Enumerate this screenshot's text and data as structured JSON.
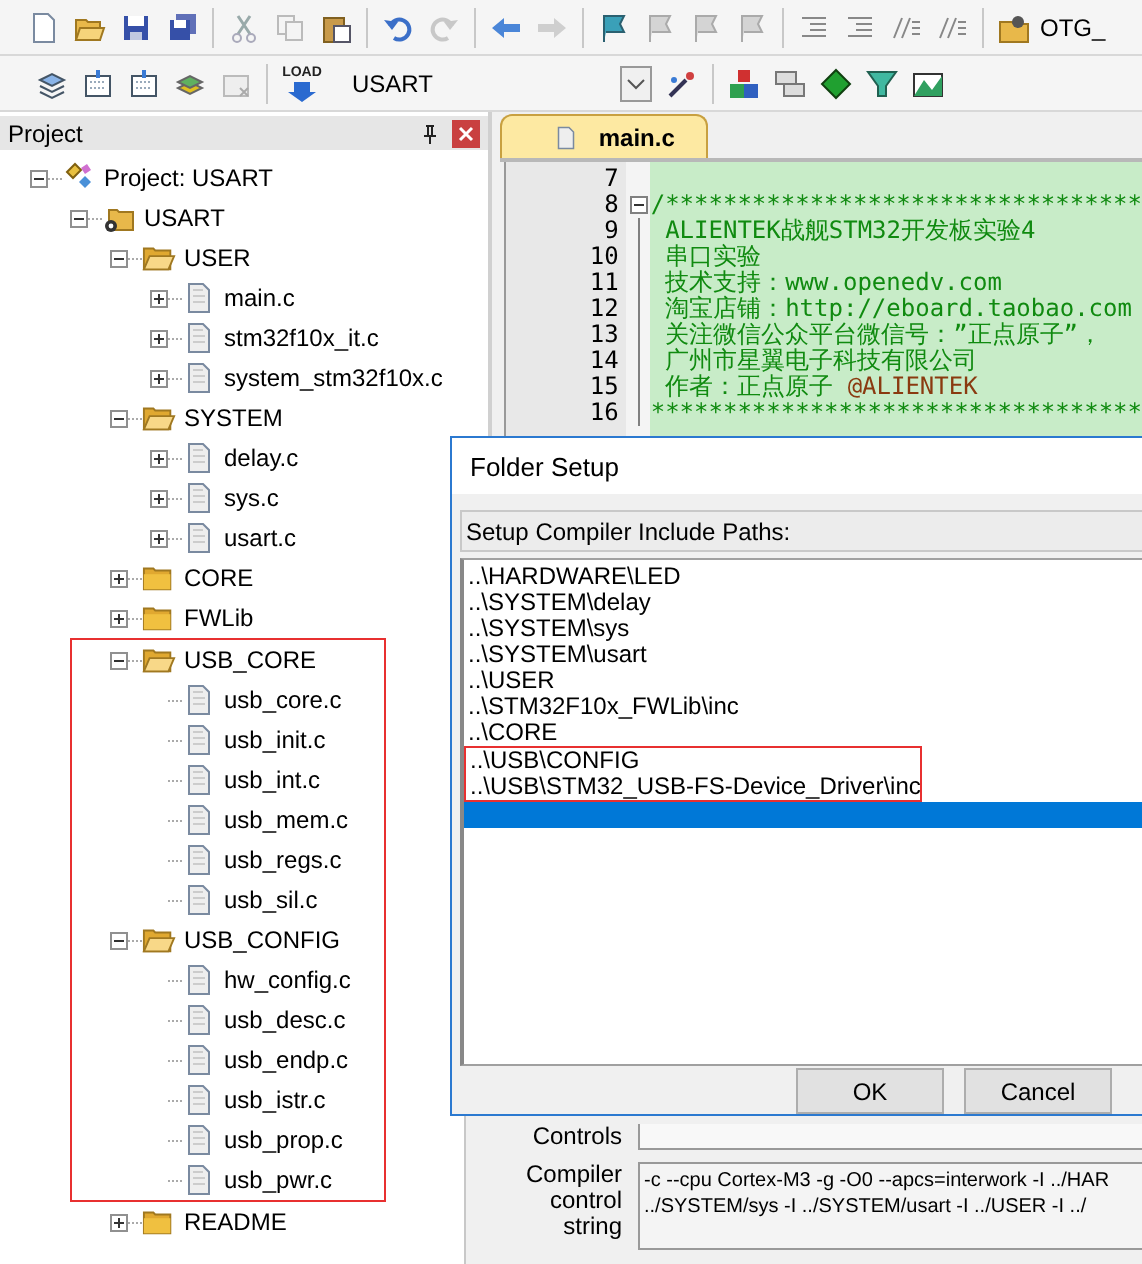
{
  "toolbar": {
    "load_caption": "LOAD",
    "target": "USART",
    "cut_text": "OTG_"
  },
  "project_panel": {
    "title": "Project",
    "tree": [
      {
        "label": "Project: USART",
        "kind": "project",
        "expanded": true,
        "children": [
          {
            "label": "USART",
            "kind": "target",
            "expanded": true,
            "children": [
              {
                "label": "USER",
                "kind": "group",
                "expanded": true,
                "children": [
                  {
                    "label": "main.c",
                    "kind": "file",
                    "expanded": false
                  },
                  {
                    "label": "stm32f10x_it.c",
                    "kind": "file",
                    "expanded": false
                  },
                  {
                    "label": "system_stm32f10x.c",
                    "kind": "file",
                    "expanded": false
                  }
                ]
              },
              {
                "label": "SYSTEM",
                "kind": "group",
                "expanded": true,
                "children": [
                  {
                    "label": "delay.c",
                    "kind": "file",
                    "expanded": false
                  },
                  {
                    "label": "sys.c",
                    "kind": "file",
                    "expanded": false
                  },
                  {
                    "label": "usart.c",
                    "kind": "file",
                    "expanded": false
                  }
                ]
              },
              {
                "label": "CORE",
                "kind": "group",
                "expanded": false
              },
              {
                "label": "FWLib",
                "kind": "group",
                "expanded": false
              },
              {
                "label": "USB_CORE",
                "kind": "group",
                "expanded": true,
                "highlighted": true,
                "children": [
                  {
                    "label": "usb_core.c",
                    "kind": "file"
                  },
                  {
                    "label": "usb_init.c",
                    "kind": "file"
                  },
                  {
                    "label": "usb_int.c",
                    "kind": "file"
                  },
                  {
                    "label": "usb_mem.c",
                    "kind": "file"
                  },
                  {
                    "label": "usb_regs.c",
                    "kind": "file"
                  },
                  {
                    "label": "usb_sil.c",
                    "kind": "file"
                  }
                ]
              },
              {
                "label": "USB_CONFIG",
                "kind": "group",
                "expanded": true,
                "highlighted": true,
                "children": [
                  {
                    "label": "hw_config.c",
                    "kind": "file"
                  },
                  {
                    "label": "usb_desc.c",
                    "kind": "file"
                  },
                  {
                    "label": "usb_endp.c",
                    "kind": "file"
                  },
                  {
                    "label": "usb_istr.c",
                    "kind": "file"
                  },
                  {
                    "label": "usb_prop.c",
                    "kind": "file"
                  },
                  {
                    "label": "usb_pwr.c",
                    "kind": "file"
                  }
                ]
              },
              {
                "label": "README",
                "kind": "group",
                "expanded": false
              }
            ]
          }
        ]
      }
    ]
  },
  "editor": {
    "tabs": [
      {
        "label": "main.c",
        "selected": true
      }
    ],
    "lines": [
      {
        "number": "7"
      },
      {
        "number": "8",
        "fold": true,
        "segments": [
          {
            "kind": "comment",
            "text": "/*********************************"
          }
        ]
      },
      {
        "number": "9",
        "segments": [
          {
            "kind": "comment",
            "text": " ALIENTEK战舰STM32开发板实验4"
          }
        ]
      },
      {
        "number": "10",
        "segments": [
          {
            "kind": "comment",
            "text": " 串口实验"
          }
        ]
      },
      {
        "number": "11",
        "segments": [
          {
            "kind": "comment",
            "text": " 技术支持：www.openedv.com"
          }
        ]
      },
      {
        "number": "12",
        "segments": [
          {
            "kind": "comment",
            "text": " 淘宝店铺：http://eboard.taobao.com"
          }
        ]
      },
      {
        "number": "13",
        "segments": [
          {
            "kind": "comment",
            "text": " 关注微信公众平台微信号：”正点原子”，"
          }
        ]
      },
      {
        "number": "14",
        "segments": [
          {
            "kind": "comment",
            "text": " 广州市星翼电子科技有限公司"
          }
        ]
      },
      {
        "number": "15",
        "segments": [
          {
            "kind": "comment",
            "text": " 作者：正点原子 "
          },
          {
            "kind": "tag",
            "text": "@ALIENTEK"
          }
        ]
      },
      {
        "number": "16",
        "segments": [
          {
            "kind": "comment",
            "text": "**********************************"
          }
        ]
      }
    ]
  },
  "options_behind": {
    "controls_label": "Controls",
    "compiler_label": "Compiler control string",
    "compiler_lines": [
      "-c --cpu Cortex-M3 -g -O0 --apcs=interwork -I ../HAR",
      "../SYSTEM/sys -I ../SYSTEM/usart -I ../USER -I ../"
    ]
  },
  "dialog": {
    "title": "Folder Setup",
    "header": "Setup Compiler Include Paths:",
    "paths": [
      {
        "path": "..\\HARDWARE\\LED",
        "selected": false
      },
      {
        "path": "..\\SYSTEM\\delay",
        "selected": false
      },
      {
        "path": "..\\SYSTEM\\sys",
        "selected": false
      },
      {
        "path": "..\\SYSTEM\\usart",
        "selected": false
      },
      {
        "path": "..\\USER",
        "selected": false
      },
      {
        "path": "..\\STM32F10x_FWLib\\inc",
        "selected": false
      },
      {
        "path": "..\\CORE",
        "selected": false
      },
      {
        "path": "..\\USB\\CONFIG",
        "selected": false,
        "highlighted": true
      },
      {
        "path": "..\\USB\\STM32_USB-FS-Device_Driver\\inc",
        "selected": false,
        "highlighted": true
      },
      {
        "selected": true
      }
    ],
    "buttons": [
      "OK",
      "Cancel"
    ]
  }
}
